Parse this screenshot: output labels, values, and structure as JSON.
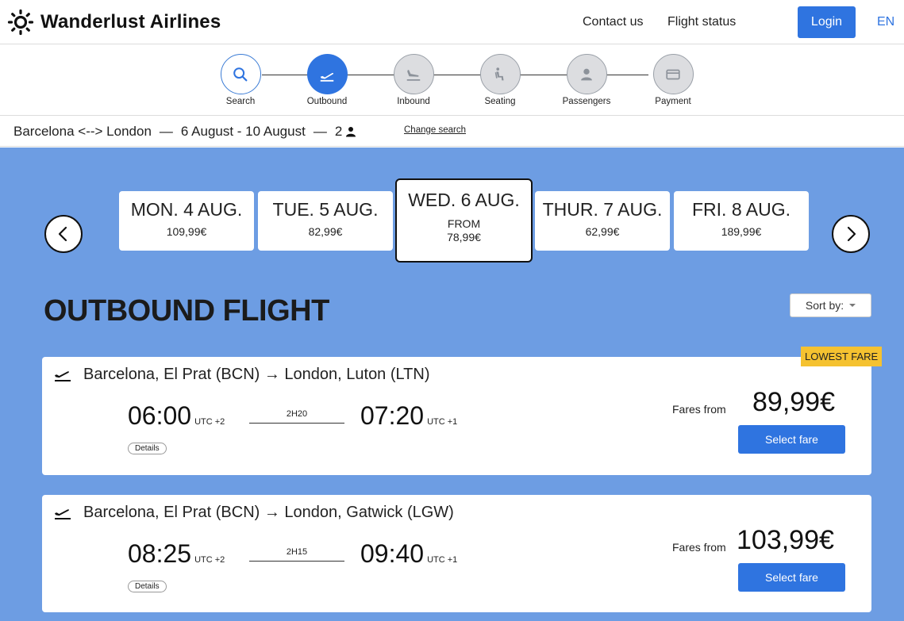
{
  "header": {
    "brand_name": "Wanderlust Airlines",
    "nav": {
      "contact": "Contact us",
      "flight_status": "Flight status"
    },
    "login_label": "Login",
    "language": "EN",
    "brand_color": "#2f74e0"
  },
  "steps": [
    {
      "label": "Search",
      "state": "done",
      "icon": "search-icon"
    },
    {
      "label": "Outbound",
      "state": "active",
      "icon": "plane-departure-icon"
    },
    {
      "label": "Inbound",
      "state": "todo",
      "icon": "plane-arrival-icon"
    },
    {
      "label": "Seating",
      "state": "todo",
      "icon": "seat-icon"
    },
    {
      "label": "Passengers",
      "state": "todo",
      "icon": "person-icon"
    },
    {
      "label": "Payment",
      "state": "todo",
      "icon": "card-icon"
    }
  ],
  "summary": {
    "route": "Barcelona <--> London",
    "dates": "6 August - 10 August",
    "separator": "—",
    "passengers": "2",
    "change_label": "Change search"
  },
  "dates": [
    {
      "label": "MON. 4 AUG.",
      "price": "109,99€",
      "selected": false
    },
    {
      "label": "TUE. 5 AUG.",
      "price": "82,99€",
      "selected": false
    },
    {
      "label": "WED. 6 AUG.",
      "from": "FROM",
      "price": "78,99€",
      "selected": true
    },
    {
      "label": "THUR. 7 AUG.",
      "price": "62,99€",
      "selected": false
    },
    {
      "label": "FRI. 8 AUG.",
      "price": "189,99€",
      "selected": false
    }
  ],
  "section": {
    "title": "OUTBOUND FLIGHT",
    "sort_label": "Sort by:"
  },
  "lowest_fare_label": "LOWEST FARE",
  "flights": [
    {
      "route": "Barcelona, El Prat (BCN) → London, Luton (LTN)",
      "depart_time": "06:00",
      "depart_tz": "UTC +2",
      "duration": "2H20",
      "arrive_time": "07:20",
      "arrive_tz": "UTC +1",
      "details_label": "Details",
      "fares_from_label": "Fares from",
      "price": "89,99€",
      "select_label": "Select fare"
    },
    {
      "route": "Barcelona, El Prat (BCN) → London, Gatwick (LGW)",
      "depart_time": "08:25",
      "depart_tz": "UTC +2",
      "duration": "2H15",
      "arrive_time": "09:40",
      "arrive_tz": "UTC +1",
      "details_label": "Details",
      "fares_from_label": "Fares from",
      "price": "103,99€",
      "select_label": "Select fare"
    }
  ]
}
